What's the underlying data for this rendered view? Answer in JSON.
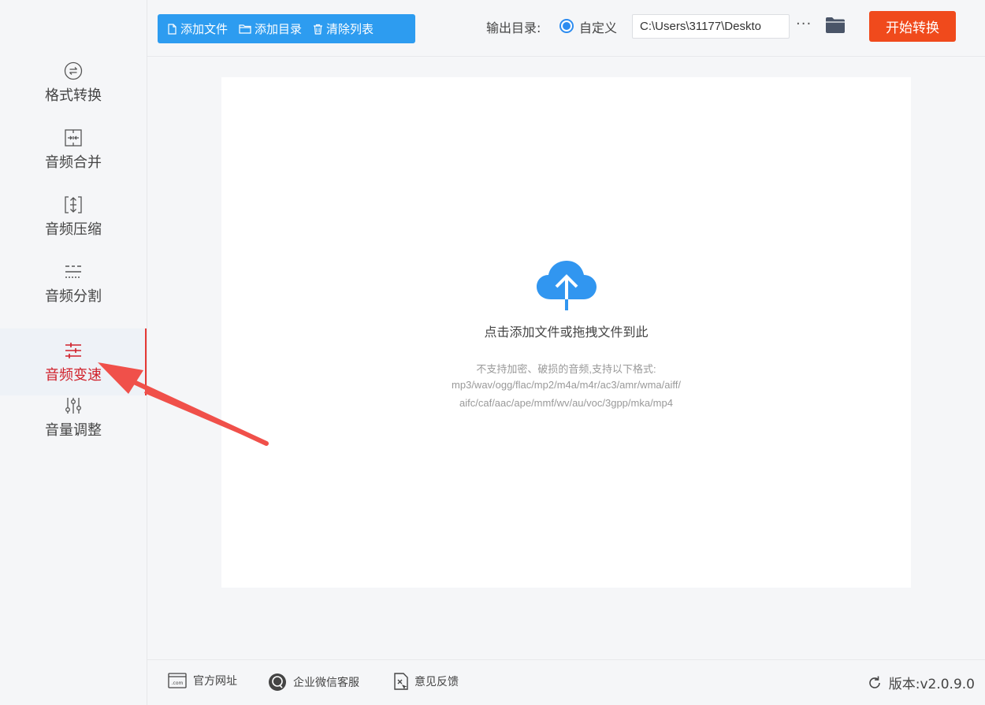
{
  "sidebar": {
    "items": [
      {
        "label": "格式转换",
        "icon": "format-convert-icon"
      },
      {
        "label": "音频合并",
        "icon": "audio-merge-icon"
      },
      {
        "label": "音频压缩",
        "icon": "audio-compress-icon"
      },
      {
        "label": "音频分割",
        "icon": "audio-split-icon"
      },
      {
        "label": "音频变速",
        "icon": "audio-speed-icon",
        "active": true
      },
      {
        "label": "音量调整",
        "icon": "volume-adjust-icon"
      }
    ]
  },
  "toolbar": {
    "add_file": "添加文件",
    "add_folder": "添加目录",
    "clear_list": "清除列表",
    "output_label": "输出目录:",
    "custom_label": "自定义",
    "output_path": "C:\\Users\\31177\\Deskto",
    "more_label": "···",
    "start_label": "开始转换"
  },
  "dropzone": {
    "title": "点击添加文件或拖拽文件到此",
    "note_line1": "不支持加密、破损的音频,支持以下格式:",
    "note_line2": "mp3/wav/ogg/flac/mp2/m4a/m4r/ac3/amr/wma/aiff/",
    "note_line3": "aifc/caf/aac/ape/mmf/wv/au/voc/3gpp/mka/mp4"
  },
  "footer": {
    "website": "官方网址",
    "wechat": "企业微信客服",
    "feedback": "意见反馈",
    "version": "版本:v2.0.9.0"
  },
  "colors": {
    "accent_blue": "#2d9cf0",
    "start_orange": "#f04a1c",
    "active_red": "#d0202a",
    "arrow_red": "#f0504a"
  }
}
